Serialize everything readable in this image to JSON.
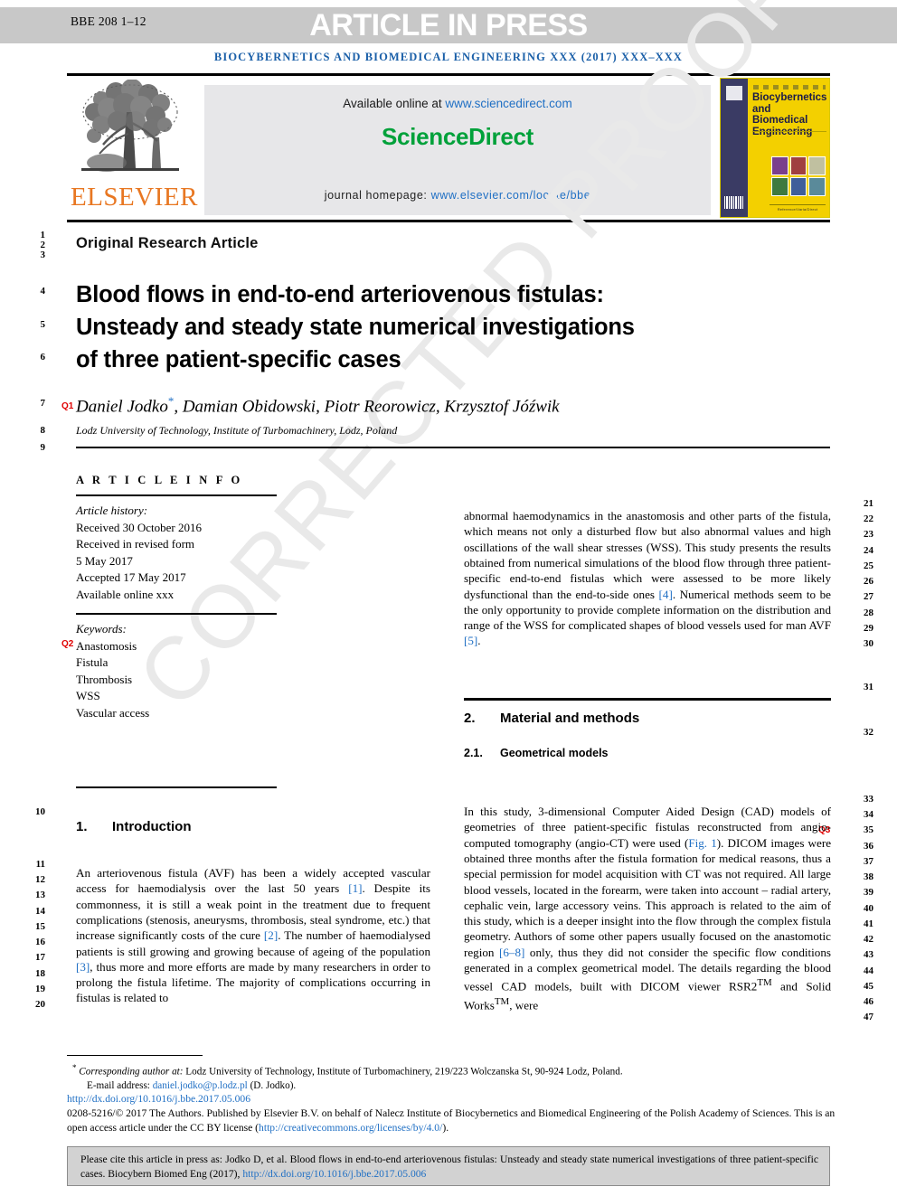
{
  "header": {
    "bbe_ref": "BBE 208 1–12",
    "article_in_press": "ARTICLE IN PRESS",
    "journal_line": "BIOCYBERNETICS AND BIOMEDICAL ENGINEERING XXX (2017) XXX–XXX"
  },
  "masthead": {
    "elsevier_wordmark": "ELSEVIER",
    "available_online_prefix": "Available online at ",
    "sciencedirect_url": "www.sciencedirect.com",
    "sciencedirect_logo": "ScienceDirect",
    "homepage_prefix": "journal homepage: ",
    "homepage_url": "www.elsevier.com/locate/bbe",
    "cover_title": "Biocybernetics and Biomedical Engineering",
    "cover_footer": "Reference/Varia/Direct"
  },
  "article": {
    "type": "Original Research Article",
    "title_line1": "Blood flows in end-to-end arteriovenous fistulas:",
    "title_line2": "Unsteady and steady state numerical investigations",
    "title_line3": "of three patient-specific cases",
    "authors": "Daniel Jodko",
    "authors_rest": ", Damian Obidowski, Piotr Reorowicz, Krzysztof Jóźwik",
    "affiliation": "Lodz University of Technology, Institute of Turbomachinery, Lodz, Poland"
  },
  "article_info": {
    "heading": "A R T I C L E   I N F O",
    "history_label": "Article history:",
    "received": "Received 30 October 2016",
    "revised_label": "Received in revised form",
    "revised_date": "5 May 2017",
    "accepted": "Accepted 17 May 2017",
    "available_online": "Available online xxx",
    "keywords_label": "Keywords:",
    "keywords": [
      "Anastomosis",
      "Fistula",
      "Thrombosis",
      "WSS",
      "Vascular access"
    ]
  },
  "sections": {
    "intro_num": "1.",
    "intro_title": "Introduction",
    "material_num": "2.",
    "material_title": "Material and methods",
    "geom_num": "2.1.",
    "geom_title": "Geometrical models"
  },
  "body": {
    "intro_p1_a": "An arteriovenous fistula (AVF) has been a widely accepted vascular access for haemodialysis over the last 50 years ",
    "intro_ref1": "[1]",
    "intro_p1_b": ". Despite its commonness, it is still a weak point in the treatment due to frequent complications (stenosis, aneurysms, thrombosis, steal syndrome, etc.) that increase significantly costs of the cure ",
    "intro_ref2": "[2]",
    "intro_p1_c": ". The number of haemodialysed patients is still growing and growing because of ageing of the population ",
    "intro_ref3": "[3]",
    "intro_p1_d": ", thus more and more efforts are made by many researchers in order to prolong the fistula lifetime. The majority of complications occurring in fistulas is related to",
    "right_p1_a": "abnormal haemodynamics in the anastomosis and other parts of the fistula, which means not only a disturbed flow but also abnormal values and high oscillations of the wall shear stresses (WSS). This study presents the results obtained from numerical simulations of the blood flow through three patient-specific end-to-end fistulas which were assessed to be more likely dysfunctional than the end-to-side ones ",
    "right_ref4": "[4]",
    "right_p1_b": ". Numerical methods seem to be the only opportunity to provide complete information on the distribution and range of the WSS for complicated shapes of blood vessels used for man AVF ",
    "right_ref5": "[5]",
    "right_p1_c": ".",
    "geom_p1_a": "In this study, 3-dimensional Computer Aided Design (CAD) models of geometries of three patient-specific fistulas reconstructed from angio-computed tomography (angio-CT) were used (",
    "geom_figref": "Fig. 1",
    "geom_p1_b": "). DICOM images were obtained three months after the fistula formation for medical reasons, thus a special permission for model acquisition with CT was not required. All large blood vessels, located in the forearm, were taken into account – radial artery, cephalic vein, large accessory veins. This approach is related to the aim of this study, which is a deeper insight into the flow through the complex fistula geometry. Authors of some other papers usually focused on the anastomotic region ",
    "geom_ref68": "[6–8]",
    "geom_p1_c": " only, thus they did not consider the specific flow conditions generated in a complex geometrical model. The details regarding the blood vessel CAD models, built with DICOM viewer RSR2",
    "geom_tm1": "TM",
    "geom_p1_d": " and Solid Works",
    "geom_tm2": "TM",
    "geom_p1_e": ", were"
  },
  "footer": {
    "corresponding_star": "*",
    "corresponding_label": "Corresponding author at:",
    "corresponding_text": " Lodz University of Technology, Institute of Turbomachinery, 219/223 Wolczanska St, 90-924 Lodz, Poland.",
    "email_label": "E-mail address: ",
    "email": "daniel.jodko@p.lodz.pl",
    "email_suffix": " (D. Jodko).",
    "doi": "http://dx.doi.org/10.1016/j.bbe.2017.05.006",
    "copyright_a": "0208-5216/© 2017 The Authors. Published by Elsevier B.V. on behalf of Nalecz Institute of Biocybernetics and Biomedical Engineering of the Polish Academy of Sciences. This is an open access article under the CC BY license (",
    "copyright_link": "http://creativecommons.org/licenses/by/4.0/",
    "copyright_b": ").",
    "cite_a": "Please cite this article in press as: Jodko D, et al. Blood flows in end-to-end arteriovenous fistulas: Unsteady and steady state numerical investigations of three patient-specific cases. Biocybern Biomed Eng (2017), ",
    "cite_link": "http://dx.doi.org/10.1016/j.bbe.2017.05.006"
  },
  "watermark": {
    "text": "CORRECTED PROOF"
  },
  "line_numbers": {
    "left": [
      "1",
      "2",
      "3",
      "4",
      "5",
      "6",
      "7",
      "8",
      "9",
      "10",
      "11",
      "12",
      "13",
      "14",
      "15",
      "16",
      "17",
      "18",
      "19",
      "20"
    ],
    "right": [
      "21",
      "22",
      "23",
      "24",
      "25",
      "26",
      "27",
      "28",
      "29",
      "30",
      "31",
      "32",
      "33",
      "34",
      "35",
      "36",
      "37",
      "38",
      "39",
      "40",
      "41",
      "42",
      "43",
      "44",
      "45",
      "46",
      "47"
    ]
  },
  "query_markers": {
    "q1": "Q1",
    "q2": "Q2",
    "q3": "Q3"
  },
  "colors": {
    "link": "#1f6fc4",
    "sciencedirect_green": "#00a13a",
    "elsevier_orange": "#e87722",
    "query_red": "#e00000",
    "topbar_gray": "#c8c8c8"
  }
}
